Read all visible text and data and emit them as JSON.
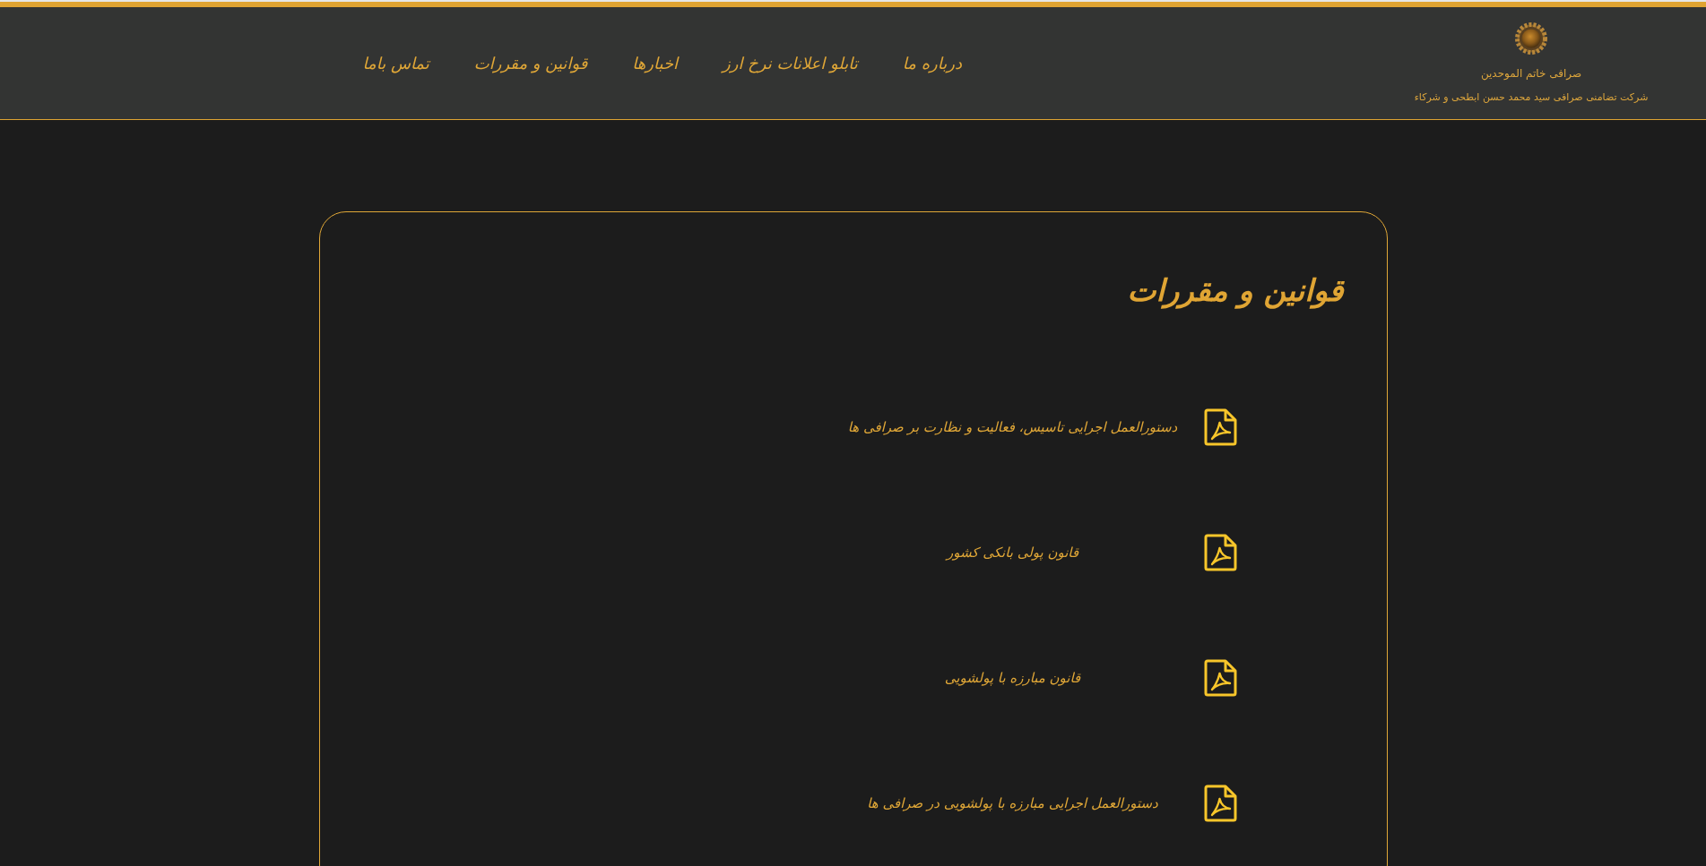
{
  "header": {
    "logo": {
      "title": "صرافی خاتم الموحدین",
      "subtitle": "شرکت تضامنی صرافی سید محمد حسن ابطحی و شرکاء"
    },
    "nav": [
      "درباره ما",
      "تابلو اعلانات نرخ ارز",
      "اخبارها",
      "قوانین و مقررات",
      "تماس باما"
    ]
  },
  "content": {
    "title": "قوانین و مقررات",
    "documents": [
      {
        "title": "دستورالعمل اجرایی تاسیس، فعالیت و نظارت بر صرافی ها"
      },
      {
        "title": "قانون پولی بانکی کشور"
      },
      {
        "title": "قانون مبارزه با پولشویی"
      },
      {
        "title": "دستورالعمل اجرایی مبارزه با پولشویی در صرافی ها"
      }
    ]
  }
}
